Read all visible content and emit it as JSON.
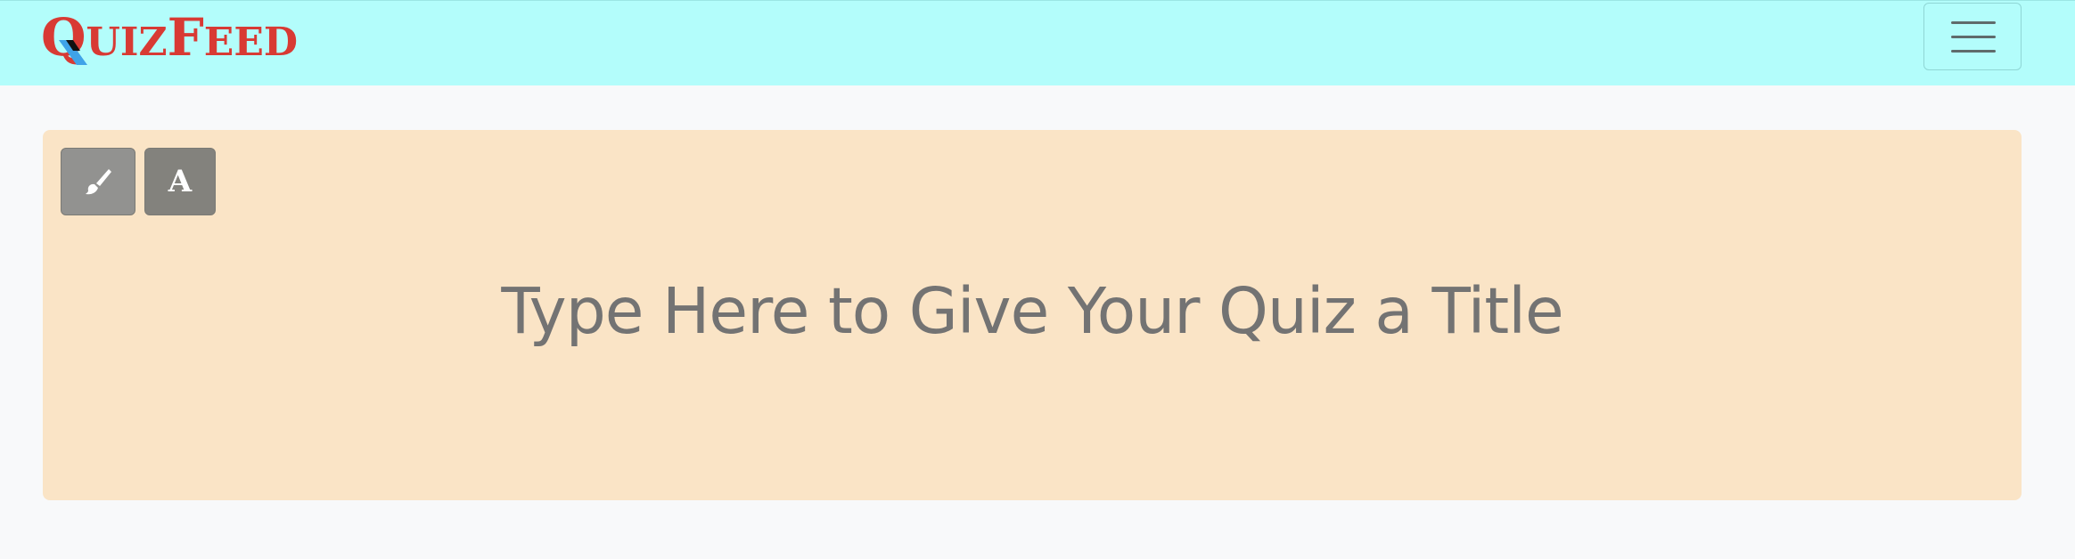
{
  "navbar": {
    "logo": {
      "big_q": "Q",
      "uiz": "UIZ",
      "big_f": "F",
      "eed": "EED"
    },
    "menu_icon": "hamburger-menu-icon"
  },
  "title_card": {
    "background_color": "#fae4c6",
    "tools": {
      "paint_icon": "paintbrush-icon",
      "font_label": "A"
    },
    "title_placeholder": "Type Here to Give Your Quiz a Title"
  },
  "colors": {
    "navbar_bg": "#b3fdfb",
    "brand": "#d83a34",
    "page_bg": "#f8f9fa"
  }
}
